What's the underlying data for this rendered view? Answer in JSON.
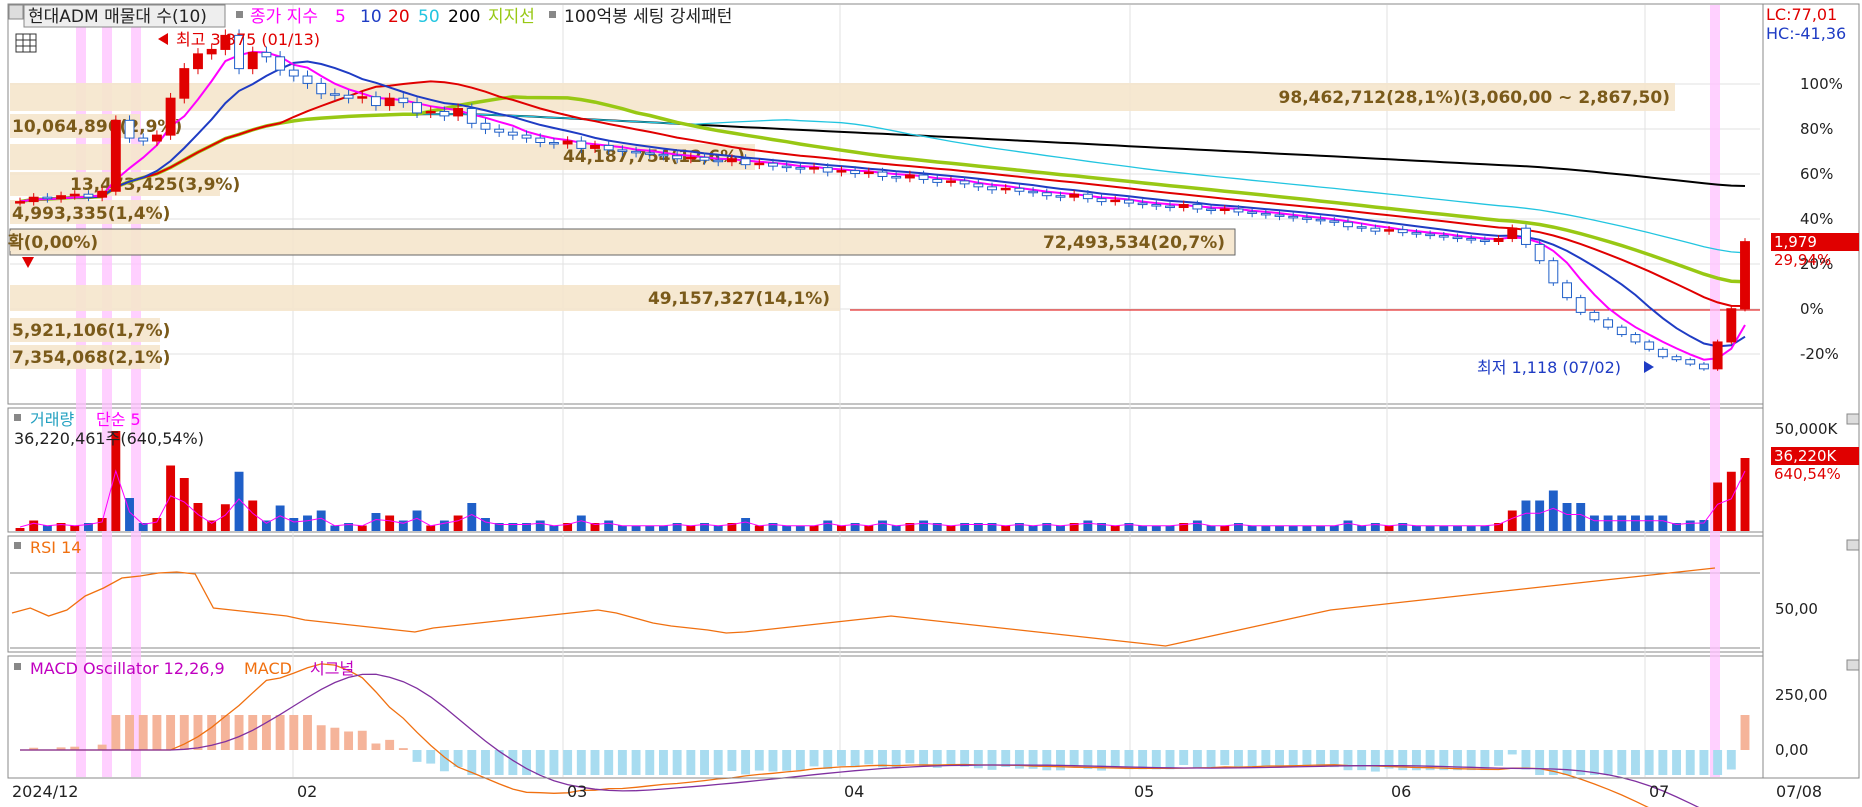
{
  "header": {
    "title": "현대ADM 매물대 수(10)",
    "ma_label": "종가 지수",
    "ma_periods": [
      "5",
      "10",
      "20",
      "50",
      "200"
    ],
    "support_label": "지지선",
    "pattern_label": "100억봉 세팅 강세패턴",
    "lc": "LC:77,01",
    "hc": "HC:-41,36"
  },
  "colors": {
    "ma5": "#ff00ff",
    "ma10": "#1f3cc4",
    "ma20": "#e00000",
    "ma50": "#22c5e0",
    "ma200": "#000000",
    "support": "#98c814",
    "up": "#e00000",
    "down": "#1f5fc8",
    "band": "#f5e6cc",
    "highlight": "#ffc0ff"
  },
  "price_panel": {
    "high_label": "최고 3,375 (01/13)",
    "low_label": "최저 1,118 (07/02)",
    "current_price": "1,979",
    "current_change": "29,94%",
    "pct_ticks": [
      "100%",
      "80%",
      "60%",
      "40%",
      "20%",
      "0%",
      "-20%"
    ],
    "volume_profile": [
      {
        "label": "98,462,712(28,1%)(3,060,00 ~ 2,867,50)",
        "pct": 28.1
      },
      {
        "label": "10,064,896(2,9%)",
        "pct": 2.9
      },
      {
        "label": "44,187,754(12,6%)",
        "pct": 12.6
      },
      {
        "label": "13,473,425(3,9%)",
        "pct": 3.9
      },
      {
        "label": "4,993,335(1,4%)",
        "pct": 1.4
      },
      {
        "label": "72,493,534(20,7%)",
        "pct": 20.7
      },
      {
        "label": "확(0,00%)",
        "pct": 0.0
      },
      {
        "label": "49,157,327(14,1%)",
        "pct": 14.1
      },
      {
        "label": "5,921,106(1,7%)",
        "pct": 1.7
      },
      {
        "label": "7,354,068(2,1%)",
        "pct": 2.1
      }
    ]
  },
  "volume_panel": {
    "label": "거래량",
    "ma_label": "단순 5",
    "value_label": "36,220,461주(640,54%)",
    "tick": "50,000K",
    "current": "36,220K",
    "current_pct": "640,54%"
  },
  "rsi_panel": {
    "label": "RSI 14",
    "tick": "50,00"
  },
  "macd_panel": {
    "label": "MACD Oscillator 12,26,9",
    "macd_label": "MACD",
    "signal_label": "시그널",
    "ticks": [
      "250,00",
      "0,00"
    ]
  },
  "x_axis": {
    "labels": [
      "2024/12",
      "02",
      "03",
      "04",
      "05",
      "06",
      "07"
    ],
    "right_label": "07/08"
  },
  "chart_data": {
    "type": "candlestick",
    "title": "현대ADM",
    "x_labels": [
      "2024/12",
      "02",
      "03",
      "04",
      "05",
      "06",
      "07"
    ],
    "close": [
      2250,
      2280,
      2270,
      2290,
      2300,
      2280,
      2320,
      2800,
      2680,
      2660,
      2700,
      2950,
      3150,
      3250,
      3280,
      3375,
      3150,
      3260,
      3230,
      3140,
      3100,
      3050,
      2980,
      2970,
      2950,
      2960,
      2900,
      2950,
      2920,
      2850,
      2860,
      2830,
      2880,
      2780,
      2740,
      2720,
      2700,
      2680,
      2650,
      2640,
      2660,
      2610,
      2630,
      2600,
      2590,
      2580,
      2570,
      2560,
      2540,
      2550,
      2530,
      2520,
      2540,
      2500,
      2510,
      2490,
      2480,
      2470,
      2480,
      2450,
      2460,
      2440,
      2450,
      2420,
      2410,
      2430,
      2400,
      2380,
      2390,
      2370,
      2350,
      2330,
      2340,
      2320,
      2310,
      2290,
      2280,
      2300,
      2270,
      2250,
      2260,
      2240,
      2230,
      2220,
      2210,
      2230,
      2200,
      2190,
      2200,
      2180,
      2170,
      2160,
      2150,
      2140,
      2130,
      2120,
      2110,
      2080,
      2070,
      2050,
      2060,
      2040,
      2030,
      2020,
      2010,
      2000,
      1990,
      1980,
      2000,
      2070,
      1960,
      1850,
      1700,
      1600,
      1500,
      1450,
      1400,
      1350,
      1300,
      1250,
      1200,
      1180,
      1150,
      1118,
      1300,
      1525,
      1979
    ],
    "rsi": [
      55,
      60,
      52,
      58,
      72,
      80,
      90,
      92,
      95,
      96,
      94,
      60,
      58,
      56,
      54,
      52,
      48,
      46,
      44,
      42,
      40,
      38,
      36,
      40,
      42,
      44,
      46,
      48,
      50,
      52,
      54,
      56,
      58,
      55,
      50,
      45,
      42,
      40,
      38,
      35,
      36,
      38,
      40,
      42,
      44,
      46,
      48,
      50,
      52,
      50,
      48,
      46,
      44,
      42,
      40,
      38,
      36,
      34,
      32,
      30,
      28,
      26,
      24,
      22,
      26,
      30,
      34,
      38,
      42,
      46,
      50,
      54,
      58,
      60,
      62,
      64,
      66,
      68,
      70,
      72,
      74,
      76,
      78,
      80,
      82,
      84,
      86,
      88,
      90,
      92,
      94,
      96,
      98,
      100
    ],
    "note": ""
  }
}
